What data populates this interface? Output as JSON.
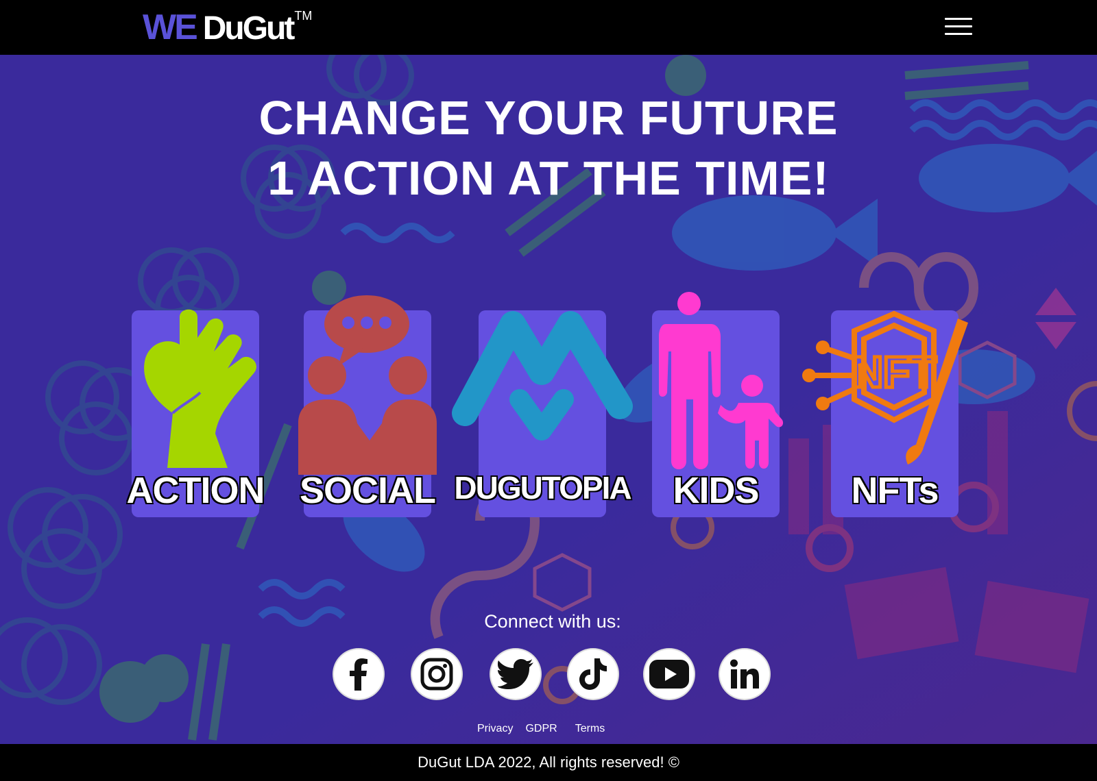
{
  "header": {
    "logo_we": "WE",
    "logo_dugut": "DuGut",
    "logo_tm": "TM"
  },
  "hero": {
    "line1": "CHANGE YOUR FUTURE",
    "line2": "1 ACTION AT THE TIME!"
  },
  "cards": [
    {
      "label": "ACTION",
      "icon": "raised-fist-icon",
      "color": "#a5d600"
    },
    {
      "label": "SOCIAL",
      "icon": "people-chat-icon",
      "color": "#b84a4a"
    },
    {
      "label": "DUGUTOPIA",
      "icon": "dugutopia-logo-icon",
      "color": "#2296c8"
    },
    {
      "label": "KIDS",
      "icon": "parent-child-icon",
      "color": "#ff3ad0"
    },
    {
      "label": "NFTs",
      "icon": "nft-brush-icon",
      "color": "#f07a10"
    }
  ],
  "connect": {
    "title": "Connect with us:",
    "networks": [
      "facebook-icon",
      "instagram-icon",
      "twitter-icon",
      "tiktok-icon",
      "youtube-icon",
      "linkedin-icon"
    ]
  },
  "links": {
    "privacy": "Privacy",
    "gdpr": "GDPR",
    "terms": "Terms"
  },
  "footer": {
    "copyright": "DuGut LDA 2022, All rights reserved! ©"
  },
  "colors": {
    "background": "#3a2a9c",
    "card": "#6450e0",
    "logo_accent": "#5a52d8",
    "bar": "#000000"
  }
}
